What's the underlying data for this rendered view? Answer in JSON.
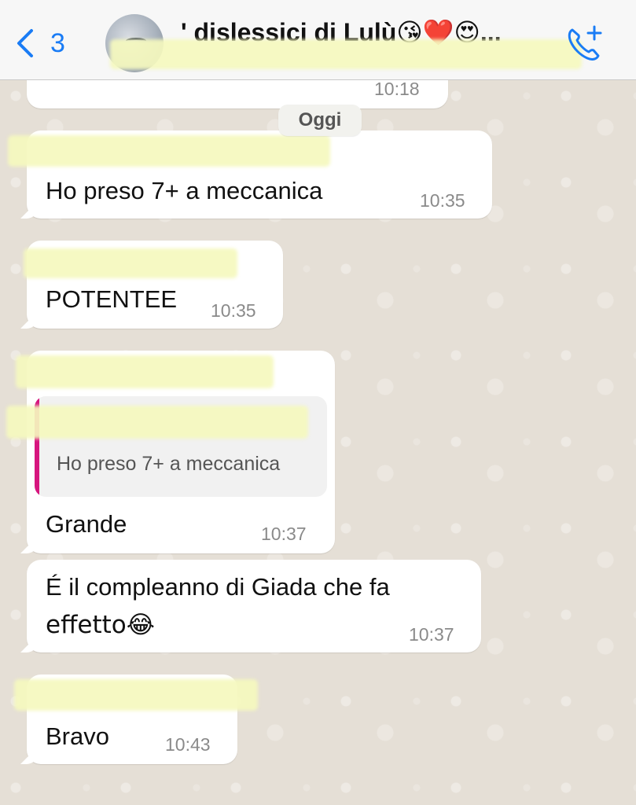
{
  "header": {
    "back_count": "3",
    "title": "' dislessici di Lulù😘❤️😍...",
    "subtitle": ""
  },
  "date_divider": "Oggi",
  "messages": [
    {
      "id": "prev",
      "time": "10:18"
    },
    {
      "id": "m1",
      "text": "Ho preso 7+ a meccanica",
      "time": "10:35"
    },
    {
      "id": "m2",
      "text": "POTENTEE",
      "time": "10:35"
    },
    {
      "id": "m3",
      "quote_text": "Ho preso 7+ a meccanica",
      "text": "Grande",
      "time": "10:37"
    },
    {
      "id": "m4",
      "text_line1": "É il compleanno di Giada che fa",
      "text_line2": "effetto😂",
      "time": "10:37"
    },
    {
      "id": "m5",
      "text": "Bravo",
      "time": "10:43"
    }
  ],
  "colors": {
    "accent": "#1a7cf5",
    "quote_bar": "#d6157e",
    "bubble": "#ffffff",
    "wallpaper": "#e5dfd6"
  },
  "icons": {
    "back": "chevron-left-icon",
    "call": "phone-plus-icon"
  }
}
